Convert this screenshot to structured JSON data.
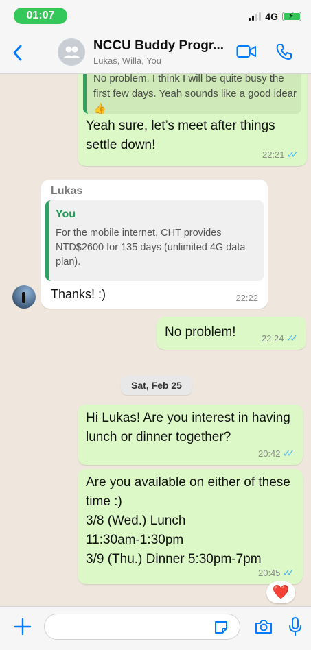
{
  "status_bar": {
    "time": "01:07",
    "network": "4G"
  },
  "header": {
    "back_icon": "chevron-left-icon",
    "title": "NCCU Buddy Progr...",
    "subtitle": "Lukas, Willa, You",
    "video_icon": "video-call-icon",
    "phone_icon": "phone-icon"
  },
  "messages": [
    {
      "direction": "outgoing",
      "quote_text": "No problem. I think I will be quite busy the first few days. Yeah sounds like a good idear👍",
      "text": "Yeah sure, let’s meet after things settle down!",
      "time": "22:21"
    },
    {
      "direction": "incoming",
      "sender": "Lukas",
      "quote_name": "You",
      "quote_text": "For the mobile internet, CHT provides NTD$2600 for 135 days (unlimited 4G data plan).",
      "text": "Thanks! :)",
      "time": "22:22"
    },
    {
      "direction": "outgoing",
      "text": "No problem!",
      "time": "22:24"
    },
    {
      "direction": "outgoing",
      "text": "Hi Lukas! Are you interest in having lunch or dinner together?",
      "time": "20:42"
    },
    {
      "direction": "outgoing",
      "text": "Are you available on either of these time :)\n3/8 (Wed.) Lunch\n11:30am-1:30pm\n3/9 (Thu.) Dinner 5:30pm-7pm",
      "time": "20:45",
      "reaction": "❤️"
    }
  ],
  "date_separator": "Sat, Feb 25",
  "input_bar": {
    "plus_icon": "plus-icon",
    "placeholder": "",
    "sticker_icon": "sticker-icon",
    "camera_icon": "camera-icon",
    "mic_icon": "microphone-icon"
  },
  "colors": {
    "accent": "#007aff",
    "outgoing_bubble": "#dcf8c6",
    "incoming_bubble": "#ffffff",
    "chat_background": "#efe7dd",
    "read_ticks": "#4fb6ec",
    "quote_accent": "#2fa163",
    "status_pill": "#34c759"
  }
}
